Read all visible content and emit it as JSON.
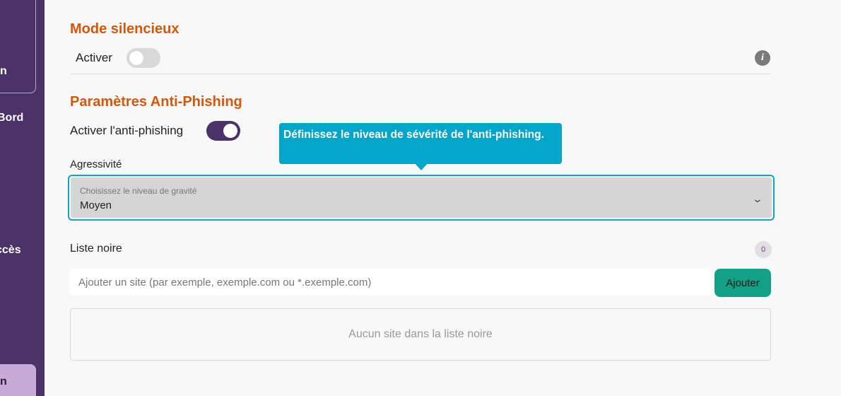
{
  "sidebar": {
    "items": [
      {
        "label": "n"
      },
      {
        "label": "Bord"
      },
      {
        "label": "ccès"
      },
      {
        "label": "n"
      }
    ],
    "background_color": "#4b3268",
    "active_color": "#c6abd6"
  },
  "silent_mode": {
    "title": "Mode silencieux",
    "toggle_label": "Activer",
    "enabled": false
  },
  "anti_phishing": {
    "title": "Paramètres Anti-Phishing",
    "toggle_label": "Activer l'anti-phishing",
    "enabled": true,
    "tooltip": "Définissez le niveau de sévérité de l'anti-phishing.",
    "aggressiveness_label": "Agressivité",
    "select_caption": "Choisissez le niveau de gravité",
    "select_value": "Moyen"
  },
  "blacklist": {
    "title": "Liste noire",
    "count": "0",
    "input_placeholder": "Ajouter un site (par exemple, exemple.com ou *.exemple.com)",
    "add_button_label": "Ajouter",
    "empty_message": "Aucun site dans la liste noire"
  },
  "colors": {
    "accent_orange": "#d0590f",
    "tooltip_blue": "#03a5c8",
    "button_green": "#14a085",
    "toggle_purple": "#4b3268"
  }
}
